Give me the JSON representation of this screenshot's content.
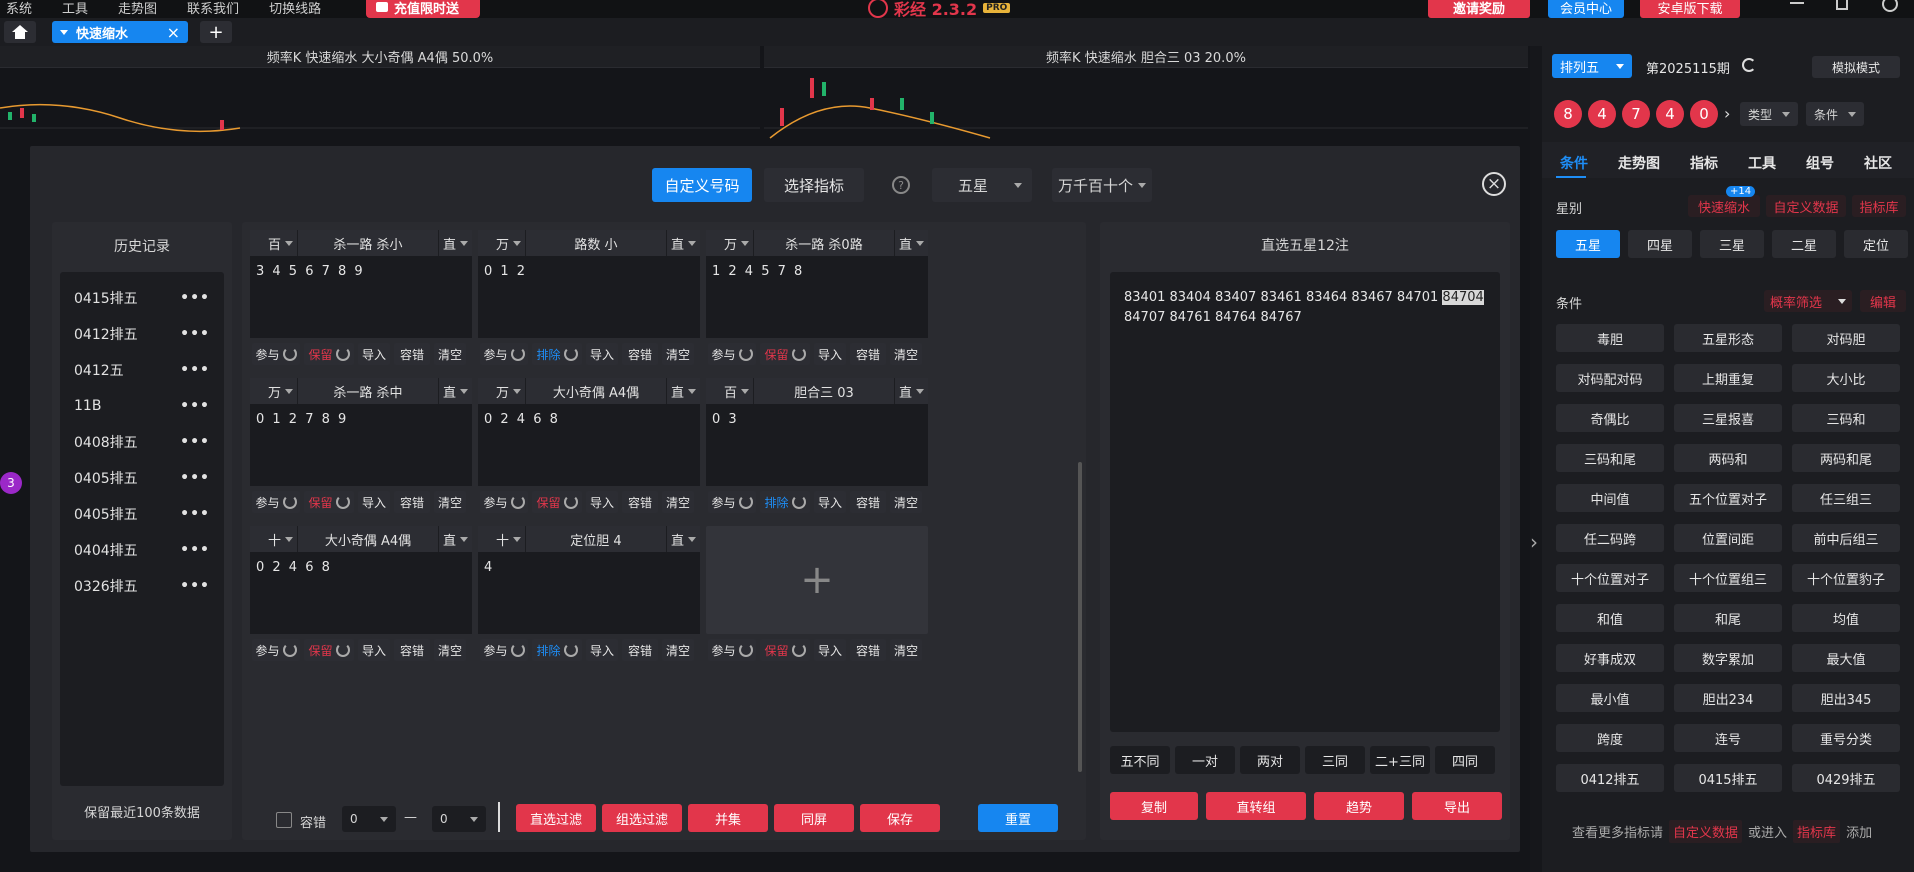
{
  "app": {
    "menu": [
      "系统",
      "工具",
      "走势图",
      "联系我们",
      "切换线路"
    ],
    "promo": "充值限时送",
    "title": "彩经 2.3.2",
    "invite": "邀请奖励",
    "member": "会员中心",
    "android": "安卓版下载"
  },
  "tabs": {
    "active": "快速缩水",
    "add": "+"
  },
  "charts": {
    "left_title": "频率K  快速缩水  大小奇偶 A4偶  50.0%",
    "right_title": "频率K  快速缩水  胆合三 03  20.0%",
    "marker": "3"
  },
  "modal": {
    "tab_custom": "自定义号码",
    "tab_indicator": "选择指标",
    "help": "?",
    "star_select": "五星",
    "pos_select": "万千百十个",
    "close": "×",
    "history": {
      "title": "历史记录",
      "items": [
        "0415排五",
        "0412排五",
        "0412五",
        "11B",
        "0408排五",
        "0405排五",
        "0405排五",
        "0404排五",
        "0326排五"
      ],
      "more": "•••",
      "footer": "保留最近100条数据"
    },
    "cells": [
      {
        "pos": "百",
        "name": "杀一路 杀小",
        "mode": "直",
        "nums": "3 4 5 6 7 8 9",
        "keep": "保留",
        "keep_color": "red"
      },
      {
        "pos": "万",
        "name": "路数 小",
        "mode": "直",
        "nums": "0 1 2",
        "keep": "排除",
        "keep_color": "blue"
      },
      {
        "pos": "万",
        "name": "杀一路 杀0路",
        "mode": "直",
        "nums": "1 2 4 5 7 8",
        "keep": "保留",
        "keep_color": "red"
      },
      {
        "pos": "万",
        "name": "杀一路 杀中",
        "mode": "直",
        "nums": "0 1 2 7 8 9",
        "keep": "保留",
        "keep_color": "red"
      },
      {
        "pos": "万",
        "name": "大小奇偶 A4偶",
        "mode": "直",
        "nums": "0 2 4 6 8",
        "keep": "保留",
        "keep_color": "red"
      },
      {
        "pos": "百",
        "name": "胆合三 03",
        "mode": "直",
        "nums": "0 3",
        "keep": "排除",
        "keep_color": "blue"
      },
      {
        "pos": "十",
        "name": "大小奇偶 A4偶",
        "mode": "直",
        "nums": "0 2 4 6 8",
        "keep": "保留",
        "keep_color": "red"
      },
      {
        "pos": "十",
        "name": "定位胆 4",
        "mode": "直",
        "nums": "4",
        "keep": "排除",
        "keep_color": "blue"
      }
    ],
    "add_cell": "+",
    "actions": {
      "join": "参与",
      "import": "导入",
      "tolerance": "容错",
      "clear": "清空"
    },
    "bottom": {
      "tolerance_label": "容错",
      "from": "0",
      "dash": "—",
      "to": "0",
      "btn_direct_filter": "直选过滤",
      "btn_group_filter": "组选过滤",
      "btn_union": "并集",
      "btn_same_screen": "同屏",
      "btn_save": "保存",
      "btn_reset": "重置"
    },
    "result": {
      "title": "直选五星12注",
      "line1": "83401 83404 83407 83461 83464 83467 84701",
      "highlight": "84704",
      "line2": "84707 84761 84764 84767",
      "filters": [
        "五不同",
        "一对",
        "两对",
        "三同",
        "二+三同",
        "四同"
      ],
      "btn_copy": "复制",
      "btn_convert": "直转组",
      "btn_trend": "趋势",
      "btn_export": "导出"
    }
  },
  "sidebar": {
    "lottery": "排列五",
    "period": "第2025115期",
    "sim_mode": "模拟模式",
    "balls": [
      "8",
      "4",
      "7",
      "4",
      "0"
    ],
    "type_select": "类型",
    "cond_select": "条件",
    "tabs": [
      "条件",
      "走势图",
      "指标",
      "工具",
      "组号",
      "社区"
    ],
    "star_label": "星别",
    "quick_shrink": "快速缩水",
    "badge": "+14",
    "custom_data": "自定义数据",
    "indicator_lib": "指标库",
    "stars": [
      "五星",
      "四星",
      "三星",
      "二星",
      "定位"
    ],
    "cond_label": "条件",
    "prob_filter": "概率筛选",
    "edit": "编辑",
    "grid": [
      "毒胆",
      "五星形态",
      "对码胆",
      "对码配对码",
      "上期重复",
      "大小比",
      "奇偶比",
      "三星报喜",
      "三码和",
      "三码和尾",
      "两码和",
      "两码和尾",
      "中间值",
      "五个位置对子",
      "任三组三",
      "任二码跨",
      "位置间距",
      "前中后组三",
      "十个位置对子",
      "十个位置组三",
      "十个位置豹子",
      "和值",
      "和尾",
      "均值",
      "好事成双",
      "数字累加",
      "最大值",
      "最小值",
      "胆出234",
      "胆出345",
      "跨度",
      "连号",
      "重号分类",
      "0412排五",
      "0415排五",
      "0429排五"
    ],
    "footer_text1": "查看更多指标请",
    "footer_custom": "自定义数据",
    "footer_text2": "或进入",
    "footer_lib": "指标库",
    "footer_text3": "添加"
  },
  "colors": {
    "accent": "#1686f0",
    "red": "#e2364b",
    "bg": "#16171b"
  }
}
